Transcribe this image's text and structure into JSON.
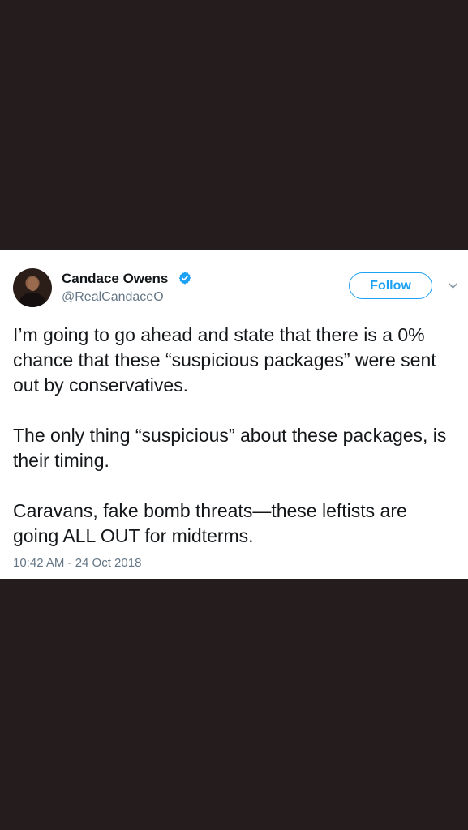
{
  "tweet": {
    "author": {
      "display_name": "Candace Owens",
      "handle": "@RealCandaceO",
      "verified": true
    },
    "follow_label": "Follow",
    "paragraphs": [
      "I’m going to go ahead and state that there is a 0% chance that these “suspicious packages” were sent out by conservatives.",
      "The only thing “suspicious” about these packages, is their timing.",
      "Caravans, fake bomb threats—these leftists are going ALL OUT for midterms."
    ],
    "timestamp": "10:42 AM - 24 Oct 2018"
  },
  "colors": {
    "background": "#251c1d",
    "card": "#ffffff",
    "accent": "#1da1f2",
    "secondary_text": "#657786",
    "primary_text": "#14171a"
  },
  "icons": {
    "verified": "verified-badge-icon",
    "menu": "chevron-down-icon"
  }
}
